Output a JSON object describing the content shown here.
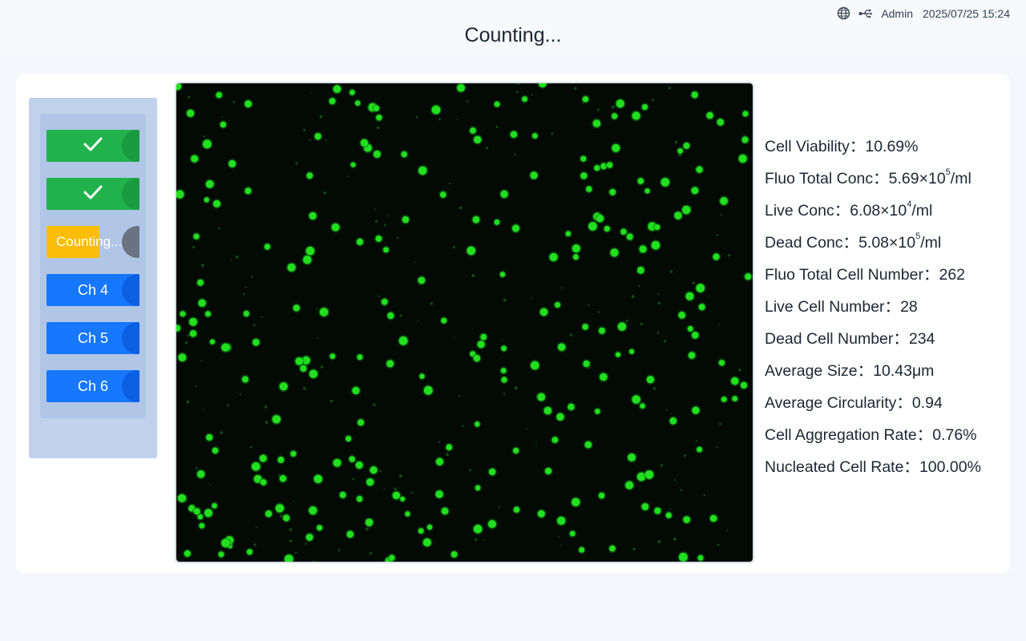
{
  "status_bar": {
    "globe_icon": "globe-icon",
    "usb_icon": "usb-icon",
    "user": "Admin",
    "datetime": "2025/07/25 15:24"
  },
  "header": {
    "title": "Counting..."
  },
  "channels": [
    {
      "label": "",
      "state": "done",
      "icon": "check-icon"
    },
    {
      "label": "",
      "state": "done",
      "icon": "check-icon"
    },
    {
      "label": "Counting...",
      "state": "counting",
      "progress": 0.57
    },
    {
      "label": "Ch 4",
      "state": "idle"
    },
    {
      "label": "Ch 5",
      "state": "idle"
    },
    {
      "label": "Ch 6",
      "state": "idle"
    }
  ],
  "colors": {
    "done": "#22b24c",
    "counting": "#fbbd08",
    "idle": "#1677ff",
    "cell_fluorescence": "#22e01f"
  },
  "stats": {
    "viability": {
      "label": "Cell Viability：",
      "value": "10.69%"
    },
    "fluo_total_conc": {
      "label": "Fluo Total Conc：",
      "mantissa": "5.69×10",
      "exp": "5",
      "unit": "/ml"
    },
    "live_conc": {
      "label": "Live Conc：",
      "mantissa": "6.08×10",
      "exp": "4",
      "unit": "/ml"
    },
    "dead_conc": {
      "label": "Dead Conc：",
      "mantissa": "5.08×10",
      "exp": "5",
      "unit": "/ml"
    },
    "fluo_total_number": {
      "label": "Fluo Total Cell Number：",
      "value": "262"
    },
    "live_number": {
      "label": "Live Cell Number：",
      "value": "28"
    },
    "dead_number": {
      "label": "Dead Cell Number：",
      "value": "234"
    },
    "avg_size": {
      "label": "Average Size：",
      "value": "10.43μm"
    },
    "avg_circularity": {
      "label": "Average Circularity：",
      "value": "0.94"
    },
    "aggregation_rate": {
      "label": "Cell Aggregation Rate：",
      "value": "0.76%"
    },
    "nucleated_rate": {
      "label": "Nucleated Cell Rate：",
      "value": "100.00%"
    }
  }
}
